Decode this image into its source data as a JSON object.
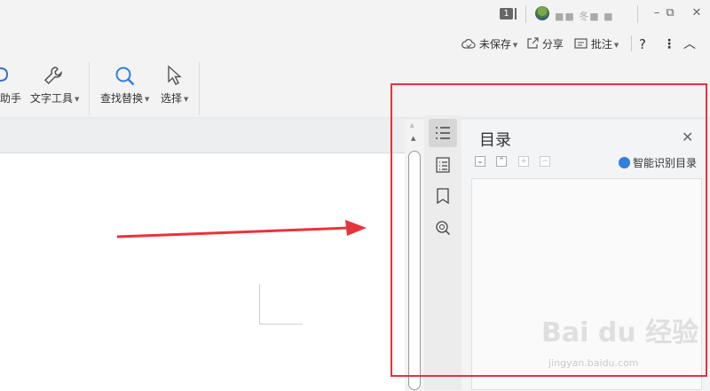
{
  "titlebar": {
    "tab_count": "1",
    "username": "■■ 冬■ ■",
    "buttons": {
      "minimize": "–",
      "restore": "⧉",
      "close": "✕"
    }
  },
  "menu": {
    "unsaved": "未保存",
    "share": "分享",
    "comment": "批注",
    "help": "?",
    "more": "⋮",
    "collapse": "︿"
  },
  "ribbon": {
    "assistant": "助手",
    "text_tools": "文字工具",
    "find_replace": "查找替换",
    "select": "选择"
  },
  "toc_panel": {
    "title": "目录",
    "smart_detect": "智能识别目录",
    "close": "✕",
    "buttons": [
      "⌄",
      "⌃",
      "+",
      "−"
    ]
  },
  "watermark": {
    "brand": "Bai du 经验",
    "url": "jingyan.baidu.com"
  },
  "colors": {
    "annotation_red": "#e8333a",
    "smart_blue": "#2f7fe0"
  }
}
